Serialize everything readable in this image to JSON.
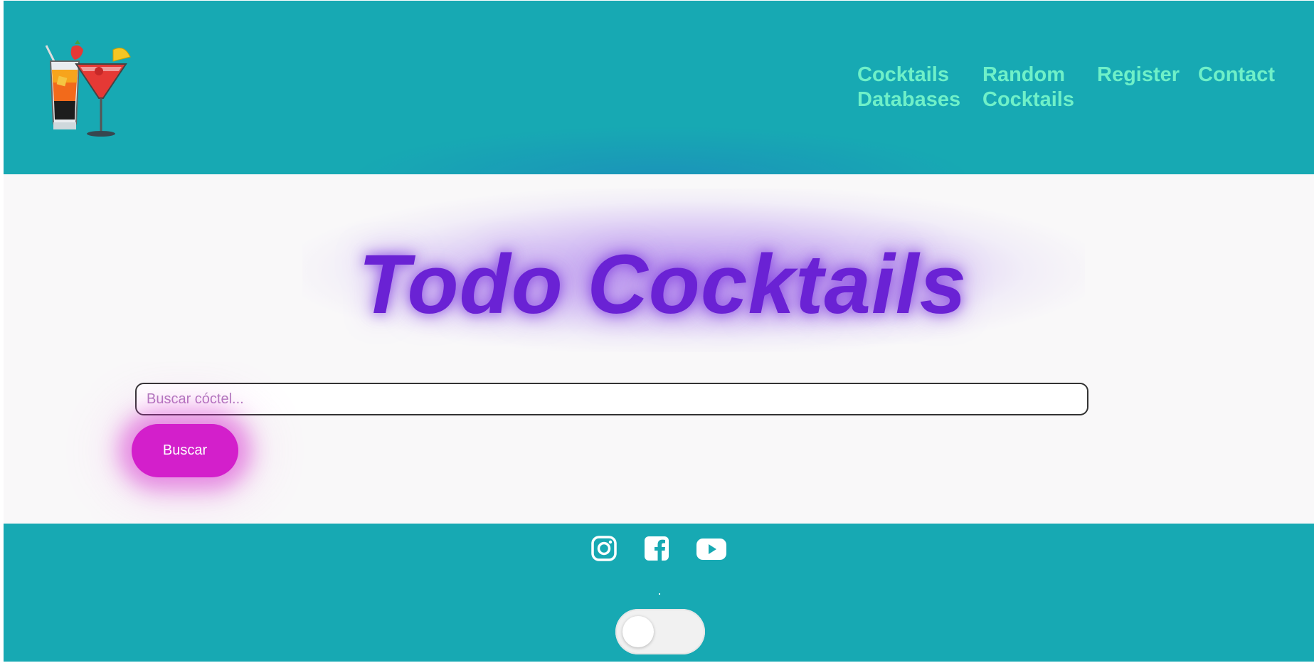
{
  "header": {
    "logo_icon": "cocktail-glasses-icon",
    "nav": [
      {
        "label": "Cocktails Databases"
      },
      {
        "label": "Random Cocktails"
      },
      {
        "label": "Register"
      },
      {
        "label": "Contact"
      }
    ]
  },
  "hero": {
    "title": "Todo Cocktails",
    "search": {
      "placeholder": "Buscar cóctel...",
      "value": ""
    },
    "button_label": "Buscar"
  },
  "footer": {
    "social": [
      "instagram-icon",
      "facebook-icon",
      "youtube-icon"
    ],
    "theme_toggle": {
      "on": false
    }
  },
  "colors": {
    "header_bg": "#17a9b3",
    "nav_text": "#6ff0c8",
    "title": "#6a22d4",
    "button": "#d31fcb",
    "page_bg": "#f9f8f9"
  }
}
